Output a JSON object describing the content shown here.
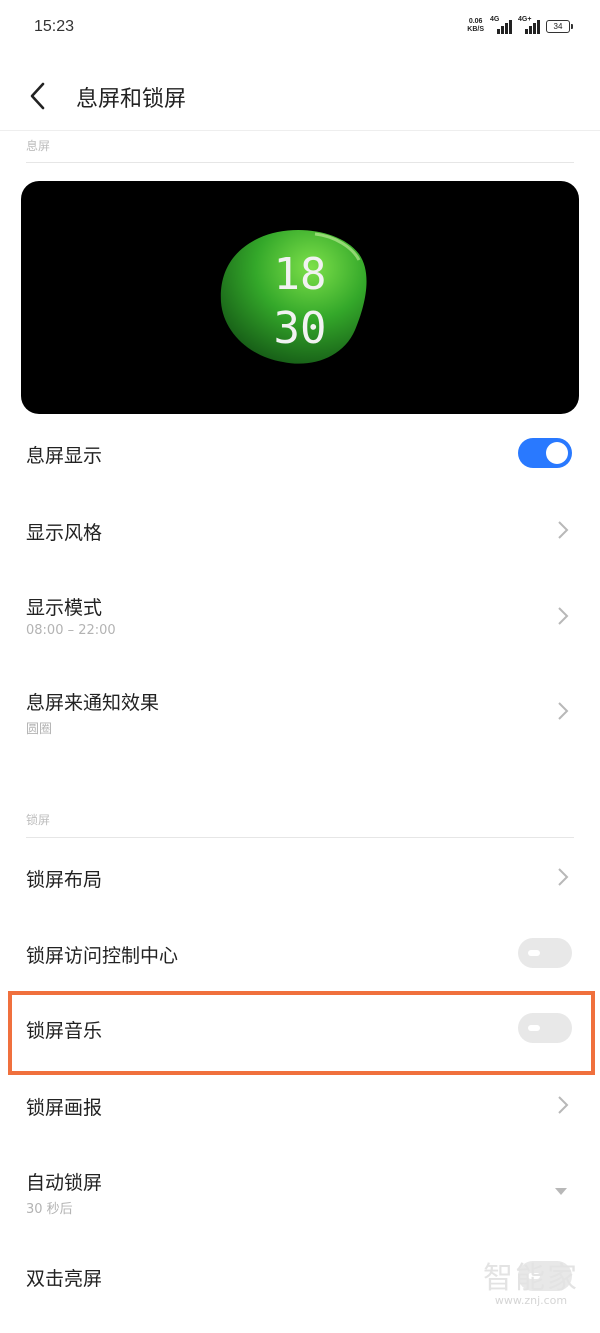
{
  "status_bar": {
    "time": "15:23",
    "net_speed_value": "0.06",
    "net_speed_unit": "KB/S",
    "sim1_label": "4G",
    "sim2_label": "4G+",
    "battery": "34"
  },
  "header": {
    "title": "息屏和锁屏"
  },
  "aod_section": {
    "label": "息屏",
    "preview": {
      "hour": "18",
      "minute": "30"
    },
    "items": [
      {
        "title": "息屏显示",
        "control": "toggle",
        "state": "on"
      },
      {
        "title": "显示风格",
        "control": "chevron"
      },
      {
        "title": "显示模式",
        "subtitle": "08:00 – 22:00",
        "control": "chevron"
      },
      {
        "title": "息屏来通知效果",
        "subtitle": "圆圈",
        "control": "chevron"
      }
    ]
  },
  "lock_section": {
    "label": "锁屏",
    "items": [
      {
        "title": "锁屏布局",
        "control": "chevron"
      },
      {
        "title": "锁屏访问控制中心",
        "control": "toggle",
        "state": "off"
      },
      {
        "title": "锁屏音乐",
        "control": "toggle",
        "state": "off",
        "highlighted": true
      },
      {
        "title": "锁屏画报",
        "control": "chevron"
      },
      {
        "title": "自动锁屏",
        "subtitle": "30 秒后",
        "control": "dropdown"
      },
      {
        "title": "双击亮屏",
        "control": "toggle",
        "state": "off"
      }
    ]
  },
  "watermark": {
    "logo_text": "智能家",
    "url": "www.znj.com"
  },
  "colors": {
    "accent": "#2979ff",
    "highlight": "#f0703d",
    "toggle_off": "#e8e8e8",
    "blob_green": "#3fbf2a"
  }
}
